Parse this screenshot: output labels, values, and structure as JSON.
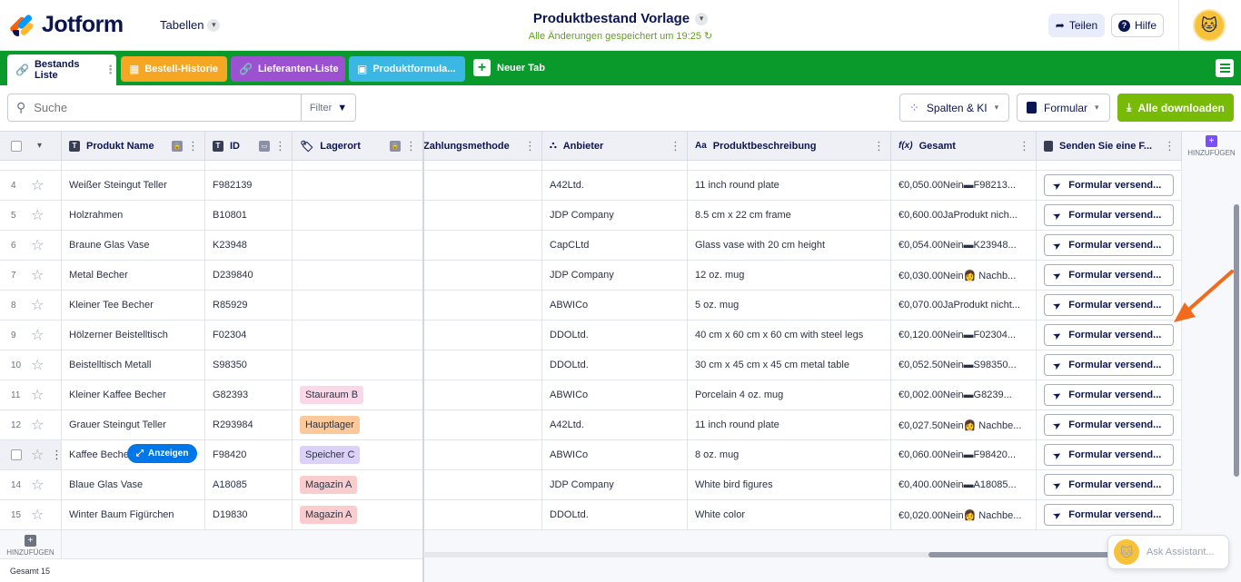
{
  "header": {
    "logo_text": "Jotform",
    "tabellen_label": "Tabellen",
    "title": "Produktbestand Vorlage",
    "saved_status": "Alle Änderungen gespeichert um 19:25",
    "share_label": "Teilen",
    "help_label": "Hilfe"
  },
  "tabs": [
    {
      "label": "Bestands Liste",
      "active": true,
      "color": "#ffffff"
    },
    {
      "label": "Bestell-Historie",
      "color": "#f5a623"
    },
    {
      "label": "Lieferanten-Liste",
      "color": "#9b51d0"
    },
    {
      "label": "Produktformula...",
      "color": "#3bb7e4"
    }
  ],
  "new_tab_label": "Neuer Tab",
  "toolbar": {
    "search_placeholder": "Suche",
    "filter_label": "Filter",
    "columns_ai_label": "Spalten & KI",
    "form_label": "Formular",
    "download_label": "Alle downloaden"
  },
  "columns": {
    "name": "Produkt Name",
    "id": "ID",
    "location": "Lagerort",
    "payment": "Zahlungsmethode",
    "supplier": "Anbieter",
    "description": "Produktbeschreibung",
    "total": "Gesamt",
    "send": "Senden Sie eine F..."
  },
  "add_label": "HINZUFÜGEN",
  "rows": [
    {
      "num": "4",
      "name": "Weißer Steingut Teller",
      "id": "F982139",
      "location": "",
      "supplier": "A42Ltd.",
      "description": "11 inch round plate",
      "total": "€0,050.00Nein▬F98213..."
    },
    {
      "num": "5",
      "name": "Holzrahmen",
      "id": "B10801",
      "location": "",
      "supplier": "JDP Company",
      "description": "8.5 cm x 22 cm frame",
      "total": "€0,600.00JaProdukt nich..."
    },
    {
      "num": "6",
      "name": "Braune Glas Vase",
      "id": "K23948",
      "location": "",
      "supplier": "CapCLtd",
      "description": "Glass vase with 20 cm height",
      "total": "€0,054.00Nein▬K23948..."
    },
    {
      "num": "7",
      "name": "Metal Becher",
      "id": "D239840",
      "location": "",
      "supplier": "JDP Company",
      "description": "12 oz. mug",
      "total": "€0,030.00Nein👩 Nachb..."
    },
    {
      "num": "8",
      "name": "Kleiner Tee Becher",
      "id": "R85929",
      "location": "",
      "supplier": "ABWICo",
      "description": "5 oz. mug",
      "total": "€0,070.00JaProdukt nicht..."
    },
    {
      "num": "9",
      "name": "Hölzerner Beistelltisch",
      "id": "F02304",
      "location": "",
      "supplier": "DDOLtd.",
      "description": "40 cm x 60 cm x 60 cm with steel legs",
      "total": "€0,120.00Nein▬F02304..."
    },
    {
      "num": "10",
      "name": "Beistelltisch Metall",
      "id": "S98350",
      "location": "",
      "supplier": "DDOLtd.",
      "description": "30 cm x 45 cm x 45 cm metal table",
      "total": "€0,052.50Nein▬S98350..."
    },
    {
      "num": "11",
      "name": "Kleiner Kaffee Becher",
      "id": "G82393",
      "location": "Stauraum B",
      "loc_color": "#fbd8e7",
      "supplier": "ABWICo",
      "description": "Porcelain 4 oz. mug",
      "total": "€0,002.00Nein▬G8239..."
    },
    {
      "num": "12",
      "name": "Grauer Steingut Teller",
      "id": "R293984",
      "location": "Hauptlager",
      "loc_color": "#fbc99a",
      "supplier": "A42Ltd.",
      "description": "11 inch round plate",
      "total": "€0,027.50Nein👩 Nachbe..."
    },
    {
      "num": "",
      "name": "Kaffee Becher",
      "id": "F98420",
      "location": "Speicher C",
      "loc_color": "#dcd2f7",
      "supplier": "ABWICo",
      "description": "8 oz. mug",
      "total": "€0,060.00Nein▬F98420..."
    },
    {
      "num": "14",
      "name": "Blaue Glas Vase",
      "id": "A18085",
      "location": "Magazin A",
      "loc_color": "#f9cdcd",
      "supplier": "JDP Company",
      "description": "White bird figures",
      "total": "€0,400.00Nein▬A18085..."
    },
    {
      "num": "15",
      "name": "Winter Baum Figürchen",
      "id": "D19830",
      "location": "Magazin A",
      "loc_color": "#f9cdcd",
      "supplier": "DDOLtd.",
      "description": "White color",
      "total": "€0,020.00Nein👩 Nachbe..."
    }
  ],
  "send_button_label": "Formular versend...",
  "anzeigen_label": "Anzeigen",
  "total_label": "Gesamt 15",
  "assistant_placeholder": "Ask Assistant..."
}
